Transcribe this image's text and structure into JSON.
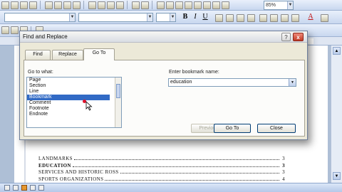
{
  "toolbar": {
    "zoom": "85%"
  },
  "format_toolbar": {
    "style_value": "",
    "font_value": "",
    "size_value": "",
    "bold_label": "B",
    "italic_label": "I",
    "underline_label": "U",
    "font_color_label": "A"
  },
  "dialog": {
    "title": "Find and Replace",
    "help_label": "?",
    "close_label": "x",
    "tabs": [
      {
        "label": "Find"
      },
      {
        "label": "Replace"
      },
      {
        "label": "Go To"
      }
    ],
    "active_tab": "Go To",
    "go_to_what_label": "Go to what:",
    "go_to_items": [
      "Page",
      "Section",
      "Line",
      "Bookmark",
      "Comment",
      "Footnote",
      "Endnote"
    ],
    "selected_item": "Bookmark",
    "enter_label": "Enter bookmark name:",
    "bookmark_value": "education",
    "buttons": {
      "previous": "Previous",
      "go_to": "Go To",
      "close": "Close"
    }
  },
  "document": {
    "toc_rows": [
      {
        "label": "LANDMARKS",
        "page": "3"
      },
      {
        "label": "EDUCATION",
        "page": "3"
      },
      {
        "label": "SERVICES AND HISTORIC ROSS",
        "page": "3"
      },
      {
        "label": "SPORTS ORGANIZATIONS",
        "page": "4"
      }
    ]
  },
  "colors": {
    "selection": "#316ac5",
    "dialog_bg": "#ece9d8",
    "workspace": "#aebfd6"
  }
}
